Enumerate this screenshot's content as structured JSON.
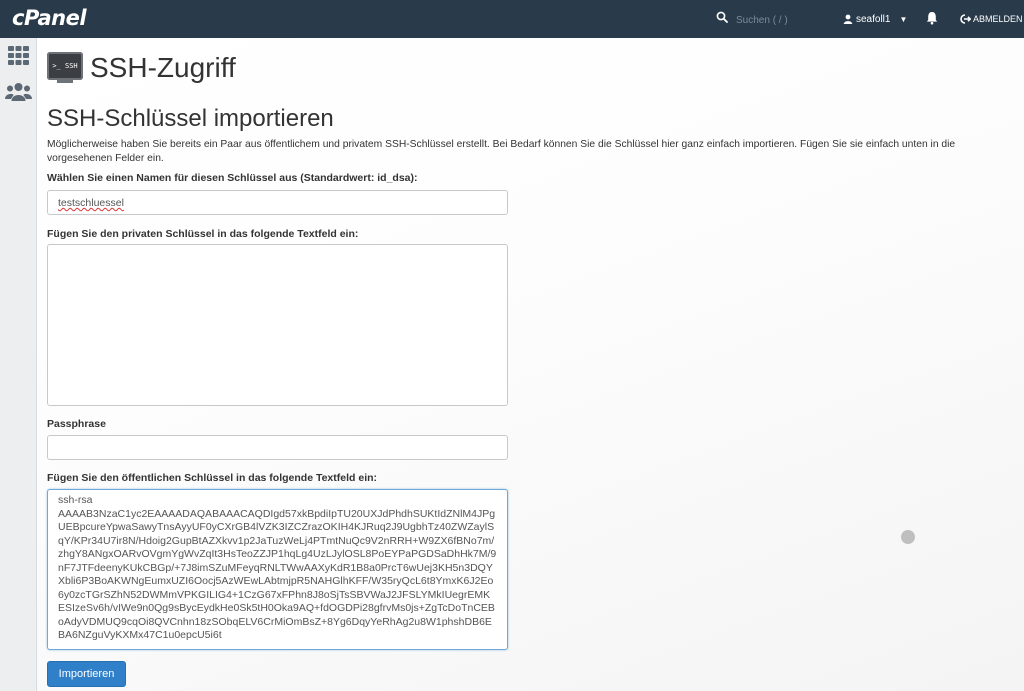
{
  "topbar": {
    "logo": "cPanel",
    "search_placeholder": "Suchen ( / )",
    "user": "seafoll1",
    "logout": "ABMELDEN"
  },
  "page": {
    "title": "SSH-Zugriff",
    "icon_text": ">_ SSH"
  },
  "form": {
    "section_title": "SSH-Schlüssel importieren",
    "intro": "Möglicherweise haben Sie bereits ein Paar aus öffentlichem und privatem SSH-Schlüssel erstellt. Bei Bedarf können Sie die Schlüssel hier ganz einfach importieren. Fügen Sie sie einfach unten in die vorgesehenen Felder ein.",
    "name_label": "Wählen Sie einen Namen für diesen Schlüssel aus (Standardwert: id_dsa):",
    "name_value": "testschluessel",
    "private_label": "Fügen Sie den privaten Schlüssel in das folgende Textfeld ein:",
    "private_value": "",
    "passphrase_label": "Passphrase",
    "passphrase_value": "",
    "public_label": "Fügen Sie den öffentlichen Schlüssel in das folgende Textfeld ein:",
    "public_value": "ssh-rsa\nAAAAB3NzaC1yc2EAAAADAQABAAACAQDIgd57xkBpdiIpTU20UXJdPhdhSUKtIdZNlM4JPgUEBpcureYpwaSawyTnsAyyUF0yCXrGB4lVZK3IZCZrazOKIH4KJRuq2J9UgbhTz40ZWZaylSqY/KPr34U7ir8N/Hdoig2GupBtAZXkvv1p2JaTuzWeLj4PTmtNuQc9V2nRRH+W9ZX6fBNo7m/zhgY8ANgxOARvOVgmYgWvZqIt3HsTeoZZJP1hqLg4UzLJylOSL8PoEYPaPGDSaDhHk7M/9nF7JTFdeenyKUkCBGp/+7J8imSZuMFeyqRNLTWwAAXyKdR1B8a0PrcT6wUej3KH5n3DQYXbli6P3BoAKWNgEumxUZI6Oocj5AzWEwLAbtmjpR5NAHGlhKFF/W35ryQcL6t8YmxK6J2Eo6y0zcTGrSZhN52DWMmVPKGILIG4+1CzG67xFPhn8J8oSjTsSBVWaJ2JFSLYMkIUegrEMKESIzeSv6h/vIWe9n0Qg9sBycEydkHe0Sk5tH0Oka9AQ+fdOGDPi28gfrvMs0js+ZgTcDoTnCEBoAdyVDMUQ9cqOi8QVCnhn18zSObqELV6CrMiOmBsZ+8Yg6DqyYeRhAg2u8W1phshDB6EBA6NZguVyKXMx47C1u0epcU5i6t",
    "submit": "Importieren"
  },
  "icons": {
    "search": "search-icon",
    "user": "user-icon",
    "bell": "bell-icon",
    "logout": "logout-icon",
    "apps": "grid-icon",
    "users": "users-icon"
  },
  "colors": {
    "topbar": "#293a4a",
    "primary_button": "#2f80c9"
  }
}
